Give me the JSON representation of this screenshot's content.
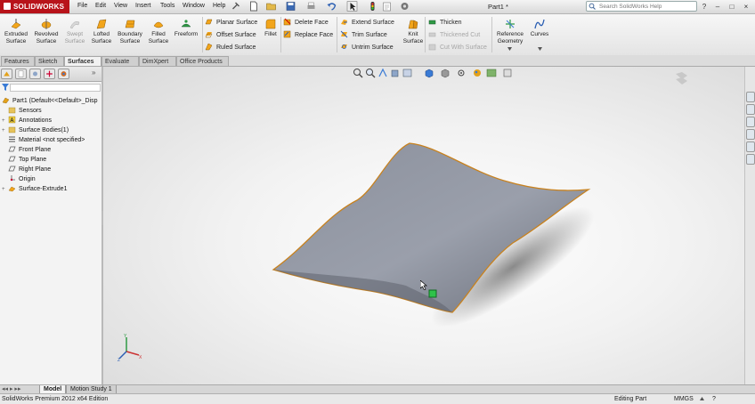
{
  "app": {
    "logo_text": "SOLIDWORKS",
    "doc_title": "Part1 *",
    "menu": [
      "File",
      "Edit",
      "View",
      "Insert",
      "Tools",
      "Window",
      "Help"
    ],
    "search_placeholder": "Search SolidWorks Help",
    "window_controls": [
      "?",
      "–",
      "□",
      "×"
    ]
  },
  "ribbon": {
    "big_buttons": [
      {
        "label": "Extruded\nSurface",
        "icon": "extruded-surface-icon"
      },
      {
        "label": "Revolved\nSurface",
        "icon": "revolved-surface-icon"
      },
      {
        "label": "Swept\nSurface",
        "icon": "swept-surface-icon"
      },
      {
        "label": "Lofted\nSurface",
        "icon": "lofted-surface-icon"
      },
      {
        "label": "Boundary\nSurface",
        "icon": "boundary-surface-icon"
      },
      {
        "label": "Filled\nSurface",
        "icon": "filled-surface-icon"
      },
      {
        "label": "Freeform",
        "icon": "freeform-icon"
      }
    ],
    "col1": [
      "Planar Surface",
      "Offset Surface",
      "Ruled Surface"
    ],
    "fillet_label": "Fillet",
    "col2": [
      "Delete Face",
      "Replace Face"
    ],
    "col3": [
      "Extend Surface",
      "Trim Surface",
      "Untrim Surface"
    ],
    "knit_label": "Knit\nSurface",
    "col4": [
      {
        "label": "Thicken",
        "disabled": false
      },
      {
        "label": "Thickened Cut",
        "disabled": true
      },
      {
        "label": "Cut With Surface",
        "disabled": true
      }
    ],
    "reference_geometry_label": "Reference\nGeometry",
    "curves_label": "Curves"
  },
  "tabs": [
    {
      "label": "Features",
      "active": false
    },
    {
      "label": "Sketch",
      "active": false
    },
    {
      "label": "Surfaces",
      "active": true
    },
    {
      "label": "Evaluate",
      "active": false
    },
    {
      "label": "DimXpert",
      "active": false
    },
    {
      "label": "Office Products",
      "active": false
    }
  ],
  "feature_tree": {
    "root": "Part1  (Default<<Default>_Disp",
    "items": [
      {
        "label": "Sensors",
        "expandable": false
      },
      {
        "label": "Annotations",
        "expandable": true
      },
      {
        "label": "Surface Bodies(1)",
        "expandable": true
      },
      {
        "label": "Material <not specified>",
        "expandable": false
      },
      {
        "label": "Front Plane",
        "expandable": false
      },
      {
        "label": "Top Plane",
        "expandable": false
      },
      {
        "label": "Right Plane",
        "expandable": false
      },
      {
        "label": "Origin",
        "expandable": false
      },
      {
        "label": "Surface-Extrude1",
        "expandable": true
      }
    ]
  },
  "bottom_tabs": [
    {
      "label": "Model",
      "active": true
    },
    {
      "label": "Motion Study 1",
      "active": false
    }
  ],
  "status": {
    "left": "SolidWorks Premium 2012 x64 Edition",
    "mode": "Editing Part",
    "units": "MMGS",
    "help": "?"
  },
  "colors": {
    "accent": "#b8131a",
    "surface": "#8a8f9c",
    "surface_edge": "#c8821f"
  }
}
